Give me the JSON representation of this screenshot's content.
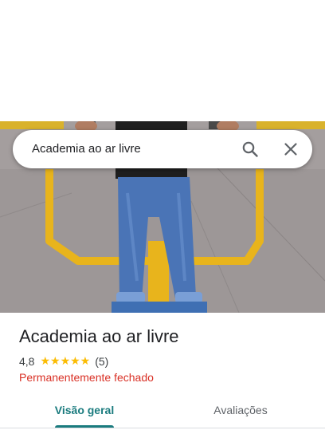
{
  "search": {
    "query": "Academia ao ar livre",
    "search_icon": "search-icon",
    "close_icon": "close-icon"
  },
  "place": {
    "title": "Academia ao ar livre",
    "rating": "4,8",
    "stars": "★★★★★",
    "review_count": "(5)",
    "status": "Permanentemente fechado"
  },
  "tabs": [
    {
      "label": "Visão geral",
      "active": true
    },
    {
      "label": "Avaliações",
      "active": false
    }
  ],
  "colors": {
    "accent": "#1a7b7e",
    "status_red": "#d93025",
    "star": "#fbbc04"
  }
}
